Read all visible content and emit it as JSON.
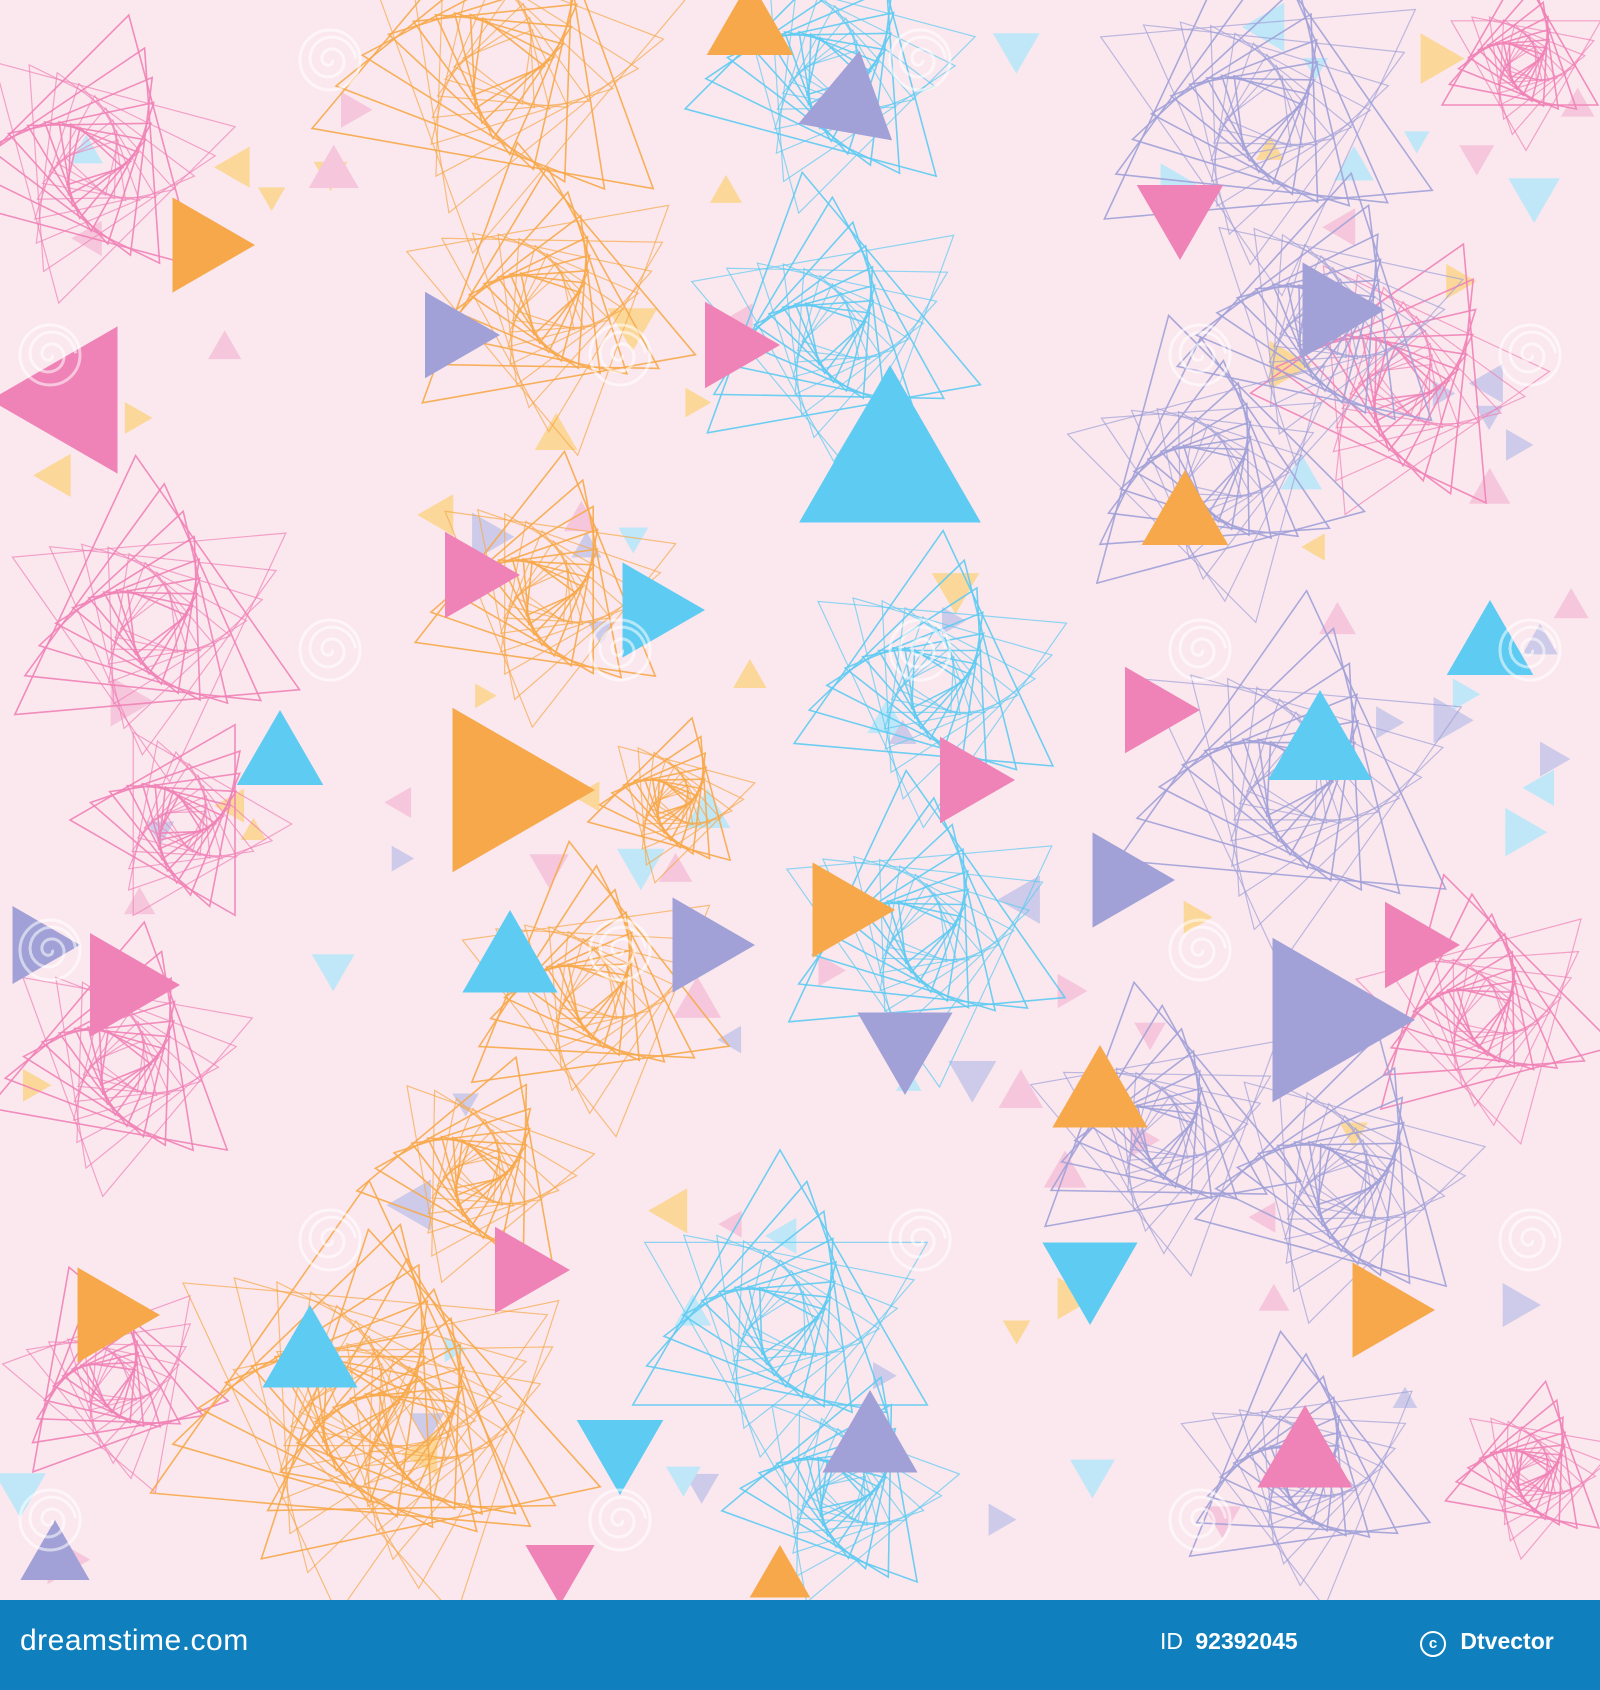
{
  "background_color": "#fbe8ee",
  "palette": {
    "pink": "#ef82b6",
    "orange": "#f7a84a",
    "blue": "#5ecbf2",
    "lavender": "#a1a1d8",
    "light_pink": "#f6c7dc",
    "light_yellow": "#fbd89a",
    "light_blue": "#bfe7f8",
    "light_lavender": "#cdcbe9"
  },
  "watermark_icon": "dreamstime-spiral-icon",
  "footer": {
    "brand": "dreamstime.com",
    "id_label": "ID",
    "id_value": "92392045",
    "author": "Dtvector",
    "copyright_icon": "copyright-icon",
    "color": "#0f7fbd"
  }
}
